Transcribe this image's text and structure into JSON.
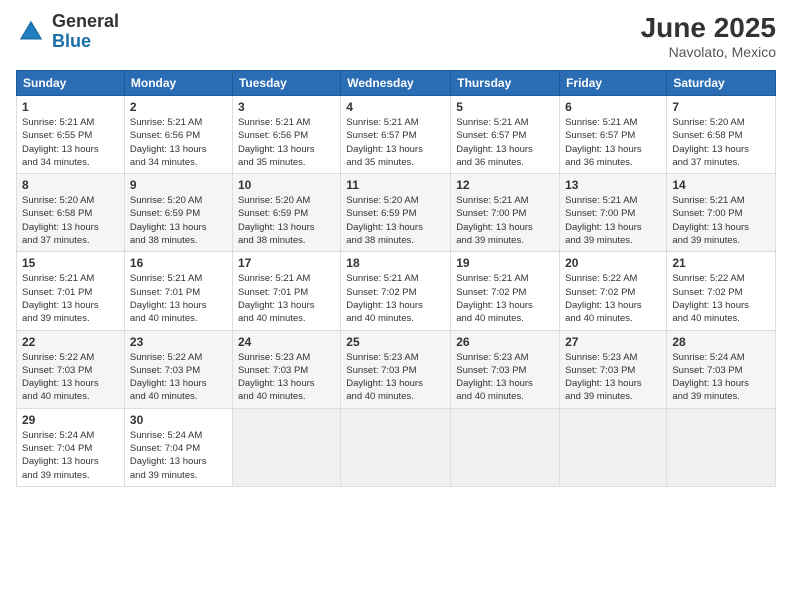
{
  "logo": {
    "general": "General",
    "blue": "Blue"
  },
  "title": {
    "month_year": "June 2025",
    "location": "Navolato, Mexico"
  },
  "weekdays": [
    "Sunday",
    "Monday",
    "Tuesday",
    "Wednesday",
    "Thursday",
    "Friday",
    "Saturday"
  ],
  "weeks": [
    [
      {
        "day": "1",
        "sunrise": "5:21 AM",
        "sunset": "6:55 PM",
        "daylight": "13 hours and 34 minutes."
      },
      {
        "day": "2",
        "sunrise": "5:21 AM",
        "sunset": "6:56 PM",
        "daylight": "13 hours and 34 minutes."
      },
      {
        "day": "3",
        "sunrise": "5:21 AM",
        "sunset": "6:56 PM",
        "daylight": "13 hours and 35 minutes."
      },
      {
        "day": "4",
        "sunrise": "5:21 AM",
        "sunset": "6:57 PM",
        "daylight": "13 hours and 35 minutes."
      },
      {
        "day": "5",
        "sunrise": "5:21 AM",
        "sunset": "6:57 PM",
        "daylight": "13 hours and 36 minutes."
      },
      {
        "day": "6",
        "sunrise": "5:21 AM",
        "sunset": "6:57 PM",
        "daylight": "13 hours and 36 minutes."
      },
      {
        "day": "7",
        "sunrise": "5:20 AM",
        "sunset": "6:58 PM",
        "daylight": "13 hours and 37 minutes."
      }
    ],
    [
      {
        "day": "8",
        "sunrise": "5:20 AM",
        "sunset": "6:58 PM",
        "daylight": "13 hours and 37 minutes."
      },
      {
        "day": "9",
        "sunrise": "5:20 AM",
        "sunset": "6:59 PM",
        "daylight": "13 hours and 38 minutes."
      },
      {
        "day": "10",
        "sunrise": "5:20 AM",
        "sunset": "6:59 PM",
        "daylight": "13 hours and 38 minutes."
      },
      {
        "day": "11",
        "sunrise": "5:20 AM",
        "sunset": "6:59 PM",
        "daylight": "13 hours and 38 minutes."
      },
      {
        "day": "12",
        "sunrise": "5:21 AM",
        "sunset": "7:00 PM",
        "daylight": "13 hours and 39 minutes."
      },
      {
        "day": "13",
        "sunrise": "5:21 AM",
        "sunset": "7:00 PM",
        "daylight": "13 hours and 39 minutes."
      },
      {
        "day": "14",
        "sunrise": "5:21 AM",
        "sunset": "7:00 PM",
        "daylight": "13 hours and 39 minutes."
      }
    ],
    [
      {
        "day": "15",
        "sunrise": "5:21 AM",
        "sunset": "7:01 PM",
        "daylight": "13 hours and 39 minutes."
      },
      {
        "day": "16",
        "sunrise": "5:21 AM",
        "sunset": "7:01 PM",
        "daylight": "13 hours and 40 minutes."
      },
      {
        "day": "17",
        "sunrise": "5:21 AM",
        "sunset": "7:01 PM",
        "daylight": "13 hours and 40 minutes."
      },
      {
        "day": "18",
        "sunrise": "5:21 AM",
        "sunset": "7:02 PM",
        "daylight": "13 hours and 40 minutes."
      },
      {
        "day": "19",
        "sunrise": "5:21 AM",
        "sunset": "7:02 PM",
        "daylight": "13 hours and 40 minutes."
      },
      {
        "day": "20",
        "sunrise": "5:22 AM",
        "sunset": "7:02 PM",
        "daylight": "13 hours and 40 minutes."
      },
      {
        "day": "21",
        "sunrise": "5:22 AM",
        "sunset": "7:02 PM",
        "daylight": "13 hours and 40 minutes."
      }
    ],
    [
      {
        "day": "22",
        "sunrise": "5:22 AM",
        "sunset": "7:03 PM",
        "daylight": "13 hours and 40 minutes."
      },
      {
        "day": "23",
        "sunrise": "5:22 AM",
        "sunset": "7:03 PM",
        "daylight": "13 hours and 40 minutes."
      },
      {
        "day": "24",
        "sunrise": "5:23 AM",
        "sunset": "7:03 PM",
        "daylight": "13 hours and 40 minutes."
      },
      {
        "day": "25",
        "sunrise": "5:23 AM",
        "sunset": "7:03 PM",
        "daylight": "13 hours and 40 minutes."
      },
      {
        "day": "26",
        "sunrise": "5:23 AM",
        "sunset": "7:03 PM",
        "daylight": "13 hours and 40 minutes."
      },
      {
        "day": "27",
        "sunrise": "5:23 AM",
        "sunset": "7:03 PM",
        "daylight": "13 hours and 39 minutes."
      },
      {
        "day": "28",
        "sunrise": "5:24 AM",
        "sunset": "7:03 PM",
        "daylight": "13 hours and 39 minutes."
      }
    ],
    [
      {
        "day": "29",
        "sunrise": "5:24 AM",
        "sunset": "7:04 PM",
        "daylight": "13 hours and 39 minutes."
      },
      {
        "day": "30",
        "sunrise": "5:24 AM",
        "sunset": "7:04 PM",
        "daylight": "13 hours and 39 minutes."
      },
      null,
      null,
      null,
      null,
      null
    ]
  ]
}
